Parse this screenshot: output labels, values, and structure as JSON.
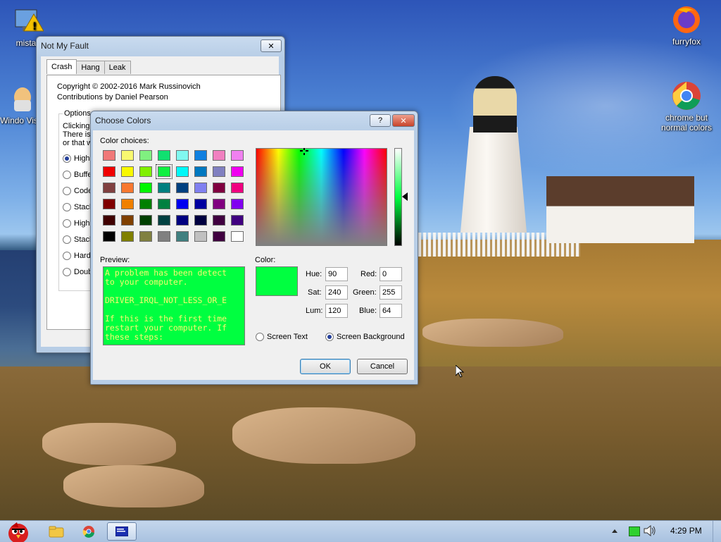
{
  "desktop_icons": [
    {
      "label": "mistak",
      "icon": "monitor-warning-icon"
    },
    {
      "label": "Windo Vista",
      "icon": "egg-icon"
    },
    {
      "label": "furryfox",
      "icon": "firefox-icon"
    },
    {
      "label": "chrome but normal colors",
      "icon": "chrome-icon"
    }
  ],
  "notmyfault": {
    "title": "Not My Fault",
    "tabs": [
      "Crash",
      "Hang",
      "Leak"
    ],
    "copyright": "Copyright © 2002-2016 Mark Russinovich",
    "contributions": "Contributions by Daniel Pearson",
    "options_label": "Options",
    "desc_lines": [
      "Clicking th",
      "There is a",
      "or that w"
    ],
    "radio_options": [
      "High I",
      "Buffer",
      "Code c",
      "Stack",
      "High I",
      "Stack",
      "Hardc",
      "Double"
    ]
  },
  "choose_colors": {
    "title": "Choose Colors",
    "help_label": "?",
    "close_label": "✕",
    "color_choices_label": "Color choices:",
    "palette": [
      "#f07878",
      "#f8f870",
      "#80f080",
      "#10e070",
      "#80f8f0",
      "#1080e0",
      "#f080c0",
      "#f080f0",
      "#f00000",
      "#f8f800",
      "#80f000",
      "#10f040",
      "#00f8f8",
      "#0078c0",
      "#8080c0",
      "#f000f0",
      "#804040",
      "#f87830",
      "#00f800",
      "#008080",
      "#004080",
      "#8080f0",
      "#800040",
      "#f00080",
      "#800000",
      "#f08000",
      "#008000",
      "#008040",
      "#0000f0",
      "#0000a0",
      "#800080",
      "#8000f0",
      "#400000",
      "#804000",
      "#004000",
      "#004040",
      "#000080",
      "#000040",
      "#400040",
      "#400080",
      "#000000",
      "#808000",
      "#808040",
      "#808080",
      "#408080",
      "#c0c0c0",
      "#400040",
      "#ffffff"
    ],
    "preview_label": "Preview:",
    "preview_lines": [
      "A problem has been detect",
      "to your computer.",
      "",
      "DRIVER_IRQL_NOT_LESS_OR_E",
      "",
      "If this is the first time",
      "restart your computer. If",
      "these steps:"
    ],
    "color_label": "Color:",
    "hue_label": "Hue:",
    "hue": "90",
    "sat_label": "Sat:",
    "sat": "240",
    "lum_label": "Lum:",
    "lum": "120",
    "red_label": "Red:",
    "red": "0",
    "green_label": "Green:",
    "green": "255",
    "blue_label": "Blue:",
    "blue": "64",
    "screen_text_label": "Screen Text",
    "screen_background_label": "Screen Background",
    "ok_label": "OK",
    "cancel_label": "Cancel",
    "current_color": "#00ff40",
    "preview_text_color": "#f8f870"
  },
  "taskbar": {
    "clock": "4:29 PM",
    "items": [
      "start-orb-icon",
      "folder-icon",
      "chrome-icon",
      "bsod-app-icon"
    ]
  }
}
